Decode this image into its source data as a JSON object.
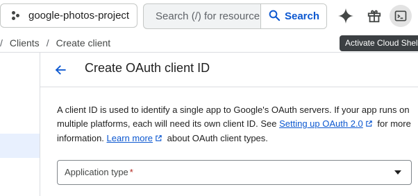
{
  "topbar": {
    "project": {
      "label": "google-photos-project",
      "icon": "project-dots-icon"
    },
    "search": {
      "placeholder": "Search (/) for resource…",
      "button_label": "Search",
      "icon": "search-icon"
    },
    "icons": [
      "gemini-sparkle-icon",
      "gift-icon",
      "cloud-shell-terminal-icon"
    ]
  },
  "tooltip": {
    "text": "Activate Cloud Shell"
  },
  "breadcrumb": {
    "separator": "/",
    "items": [
      "Clients",
      "Create client"
    ]
  },
  "page": {
    "title": "Create OAuth client ID",
    "back_icon": "arrow-back-icon"
  },
  "description": {
    "part1": "A client ID is used to identify a single app to Google's OAuth servers. If your app runs on multiple platforms, each will need its own client ID. See ",
    "link1": "Setting up OAuth 2.0",
    "part2": " for more information. ",
    "link2": "Learn more",
    "part3": " about OAuth client types."
  },
  "form": {
    "application_type": {
      "label": "Application type",
      "required_marker": "*",
      "value": ""
    }
  },
  "colors": {
    "accent": "#0b57d0",
    "required": "#b3261e",
    "nav_selected": "#e8f0fe",
    "tooltip_bg": "#3c4043",
    "border": "#dadce0"
  }
}
